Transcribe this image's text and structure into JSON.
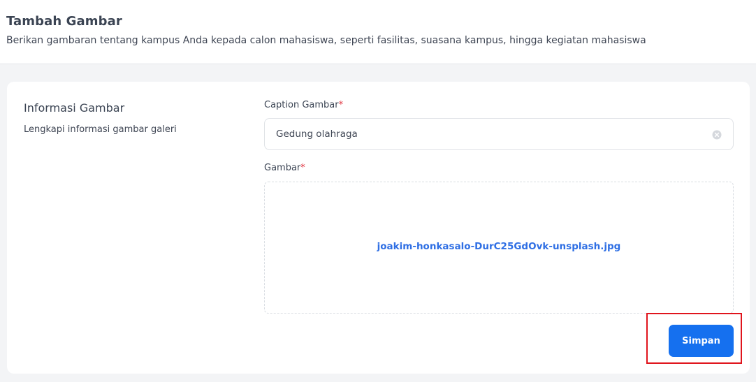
{
  "header": {
    "title": "Tambah Gambar",
    "subtitle": "Berikan gambaran tentang kampus Anda kepada calon mahasiswa, seperti fasilitas, suasana kampus, hingga kegiatan mahasiswa"
  },
  "section": {
    "title": "Informasi Gambar",
    "description": "Lengkapi informasi gambar galeri"
  },
  "caption_field": {
    "label": "Caption Gambar",
    "required_mark": "*",
    "value": "Gedung olahraga",
    "clear_icon": "clear-circle-icon"
  },
  "image_field": {
    "label": "Gambar",
    "required_mark": "*",
    "file_name": "joakim-honkasalo-DurC25GdOvk-unsplash.jpg"
  },
  "actions": {
    "save_label": "Simpan"
  },
  "colors": {
    "primary": "#1570ef",
    "link": "#2f6fe4",
    "required": "#e0343f",
    "highlight": "#e0141c"
  }
}
